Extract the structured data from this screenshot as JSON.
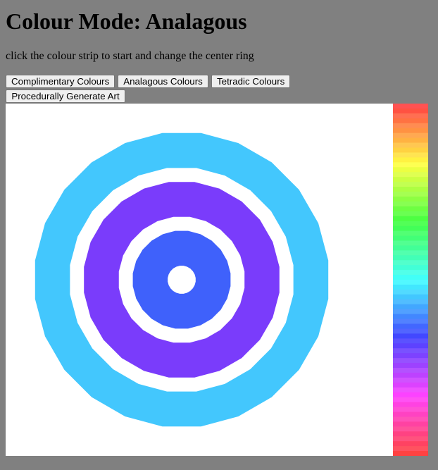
{
  "header": {
    "title": "Colour Mode: Analagous",
    "instructions": "click the colour strip to start and change the center ring"
  },
  "buttons": {
    "complimentary": "Complimentary Colours",
    "analagous": "Analagous Colours",
    "tetradic": "Tetradic Colours",
    "procedural": "Procedurally Generate Art"
  },
  "colors": {
    "page_background": "#808080",
    "canvas_background": "#ffffff",
    "outer_ring": "#43c7fd",
    "middle_ring": "#7a3cfb",
    "inner_ring": "#3f61fb",
    "gap": "#ffffff"
  },
  "colour_strip": {
    "hue_start_degrees": 0,
    "hue_end_degrees": 360,
    "bands": 72
  }
}
